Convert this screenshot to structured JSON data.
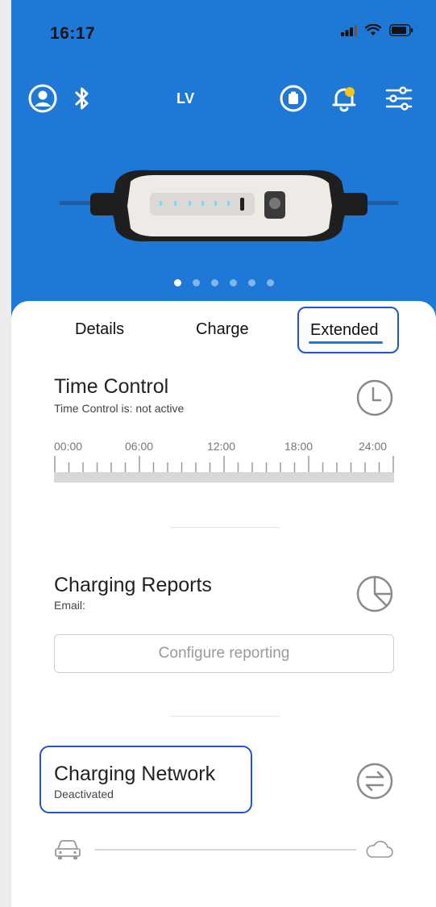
{
  "status_bar": {
    "time": "16:17"
  },
  "header": {
    "car_label": "LV",
    "icons": [
      "user-icon",
      "bluetooth-icon",
      "clipboard-icon",
      "bell-icon",
      "sliders-icon"
    ],
    "notification_dot_color": "#f5c518",
    "background_color": "#1d78d6"
  },
  "carousel": {
    "page_count": 6,
    "active_index": 0
  },
  "tabs": [
    {
      "label": "Details"
    },
    {
      "label": "Charge"
    },
    {
      "label": "Extended",
      "selected": true
    }
  ],
  "time_control": {
    "title": "Time Control",
    "status": "Time Control is: not active",
    "icon": "clock-icon",
    "tick_labels": [
      "00:00",
      "06:00",
      "12:00",
      "18:00",
      "24:00"
    ]
  },
  "charging_reports": {
    "title": "Charging Reports",
    "email_label": "Email:",
    "icon": "pie-chart-icon",
    "configure_button": "Configure reporting"
  },
  "charging_network": {
    "title": "Charging Network",
    "status": "Deactivated",
    "icon": "swap-arrows-icon",
    "left_icon": "car-icon",
    "right_icon": "cloud-icon"
  },
  "colors": {
    "accent": "#1d78d6",
    "highlight_outline": "#1f55c8"
  }
}
